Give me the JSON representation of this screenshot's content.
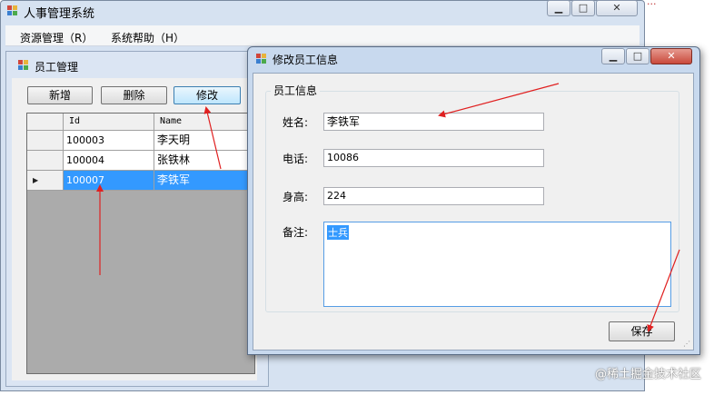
{
  "main_window": {
    "title": "人事管理系统",
    "caption": {
      "minimize": "▁",
      "maximize": "□",
      "close": "✕"
    },
    "menu": [
      {
        "label": "资源管理（R）"
      },
      {
        "label": "系统帮助（H）"
      }
    ]
  },
  "child_window": {
    "title": "员工管理",
    "buttons": {
      "add": "新增",
      "delete": "删除",
      "edit": "修改"
    },
    "grid": {
      "columns": [
        "Id",
        "Name"
      ],
      "rows": [
        {
          "id": "100003",
          "name": "李天明",
          "selected": false
        },
        {
          "id": "100004",
          "name": "张铁林",
          "selected": false
        },
        {
          "id": "100007",
          "name": "李铁军",
          "selected": true
        }
      ],
      "current_row_marker": "▶"
    }
  },
  "dialog": {
    "title": "修改员工信息",
    "caption": {
      "minimize": "▁",
      "maximize": "□",
      "close": "✕"
    },
    "group_label": "员工信息",
    "fields": {
      "name": {
        "label": "姓名:",
        "value": "李铁军"
      },
      "phone": {
        "label": "电话:",
        "value": "10086"
      },
      "height": {
        "label": "身高:",
        "value": "224"
      },
      "note": {
        "label": "备注:",
        "value": "士兵"
      }
    },
    "save_label": "保存"
  },
  "watermark": "@稀土掘金技术社区",
  "colors": {
    "selection": "#3399ff",
    "annotation_arrow": "#e02020",
    "grid_background": "#ababab"
  }
}
